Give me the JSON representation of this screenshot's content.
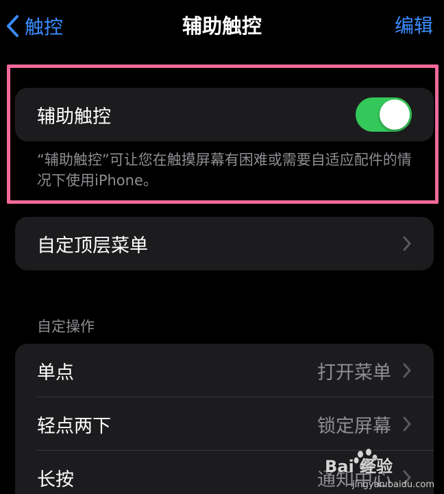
{
  "nav": {
    "back_label": "触控",
    "title": "辅助触控",
    "edit_label": "编辑"
  },
  "assistive_touch": {
    "label": "辅助触控",
    "enabled": true,
    "footnote": "“辅助触控”可让您在触摸屏幕有困难或需要自适应配件的情况下使用iPhone。"
  },
  "customize_top_menu": {
    "label": "自定顶层菜单"
  },
  "custom_actions": {
    "header": "自定操作",
    "items": [
      {
        "label": "单点",
        "value": "打开菜单"
      },
      {
        "label": "轻点两下",
        "value": "锁定屏幕"
      },
      {
        "label": "长按",
        "value": "通知中心"
      }
    ]
  },
  "watermark": {
    "brand": "Bai 经验",
    "url": "jingyan.baidu.com"
  },
  "colors": {
    "accent": "#3a8cff",
    "toggle_on": "#34c759",
    "highlight": "#f4699a",
    "card": "#1c1c1e",
    "secondary_text": "#8e8e93"
  },
  "icons": {
    "back": "chevron-left-icon",
    "disclosure": "chevron-right-icon",
    "watermark_logo": "baidu-paw-icon"
  }
}
